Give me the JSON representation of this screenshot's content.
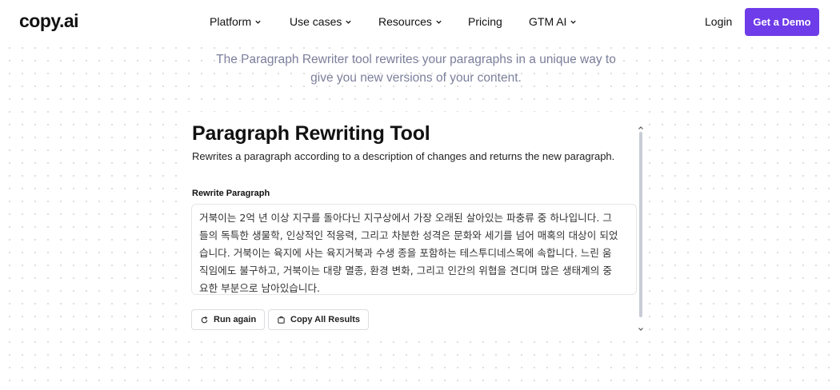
{
  "nav": {
    "logo": "copy.ai",
    "items": [
      {
        "label": "Platform",
        "dropdown": true
      },
      {
        "label": "Use cases",
        "dropdown": true
      },
      {
        "label": "Resources",
        "dropdown": true
      },
      {
        "label": "Pricing",
        "dropdown": false
      },
      {
        "label": "GTM AI",
        "dropdown": true
      }
    ],
    "login": "Login",
    "demo": "Get a Demo"
  },
  "intro": {
    "line1": "The Paragraph Rewriter tool rewrites your paragraphs in a unique way to",
    "line2": "give you new versions of your content."
  },
  "tool": {
    "title": "Paragraph Rewriting Tool",
    "subtitle": "Rewrites a paragraph according to a description of changes and returns the new paragraph.",
    "field_label": "Rewrite Paragraph",
    "result_lines": [
      "거북이는 2억 년 이상 지구를 돌아다닌 지구상에서 가장 오래된 살아있는 파충류 중 하나입니다. 그",
      "들의 독특한 생물학, 인상적인 적응력, 그리고 차분한 성격은 문화와 세기를 넘어 매혹의 대상이 되었",
      "습니다. 거북이는 육지에 사는 육지거북과 수생 종을 포함하는 테스투디네스목에 속합니다. 느린 움",
      "직임에도 불구하고, 거북이는 대량 멸종, 환경 변화, 그리고 인간의 위협을 견디며 많은 생태계의 중",
      "요한 부분으로 남아있습니다."
    ],
    "run_again": "Run again",
    "copy_all": "Copy All Results"
  },
  "colors": {
    "accent": "#6e3ce8",
    "intro_text": "#7b7f9b",
    "scroll_thumb": "#c7ccd6"
  },
  "icons": {
    "nav_dropdown": "chevron-down-icon",
    "run_again": "refresh-icon",
    "copy_all": "clipboard-icon",
    "scroll_up": "chevron-up-icon",
    "scroll_down": "chevron-down-icon"
  }
}
